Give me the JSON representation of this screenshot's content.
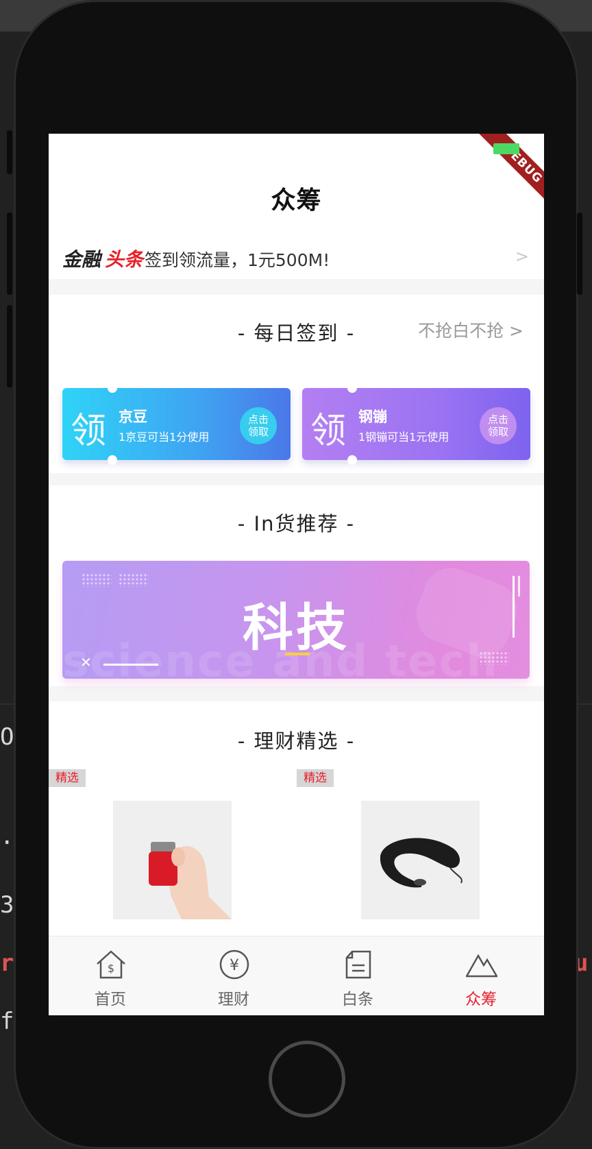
{
  "app_bar": {
    "title": "众筹",
    "debug_label": "DEBUG"
  },
  "news": {
    "brand_part1": "金融",
    "brand_part2": "头条",
    "text": "签到领流量，1元500M!",
    "arrow": ">"
  },
  "daily_signin": {
    "title": "- 每日签到 -",
    "more": "不抢白不抢 >",
    "coupons": [
      {
        "big_char": "领",
        "name": "京豆",
        "desc": "1京豆可当1分使用",
        "btn_line1": "点击",
        "btn_line2": "领取"
      },
      {
        "big_char": "领",
        "name": "钢镚",
        "desc": "1钢镚可当1元使用",
        "btn_line1": "点击",
        "btn_line2": "领取"
      }
    ]
  },
  "recommend": {
    "title": "- In货推荐 -",
    "banner_main": "科技",
    "banner_bg_text": "science and tech"
  },
  "finance": {
    "title": "- 理财精选 -",
    "tags": [
      "精选",
      "精选"
    ]
  },
  "tabs": [
    {
      "label": "首页",
      "icon": "home-icon",
      "active": false
    },
    {
      "label": "理财",
      "icon": "yen-icon",
      "active": false
    },
    {
      "label": "白条",
      "icon": "document-icon",
      "active": false
    },
    {
      "label": "众筹",
      "icon": "mountain-icon",
      "active": true
    }
  ],
  "colors": {
    "accent": "#e8202a",
    "coupon_blue": "#3fa3f2",
    "coupon_purple": "#9b73f2"
  }
}
